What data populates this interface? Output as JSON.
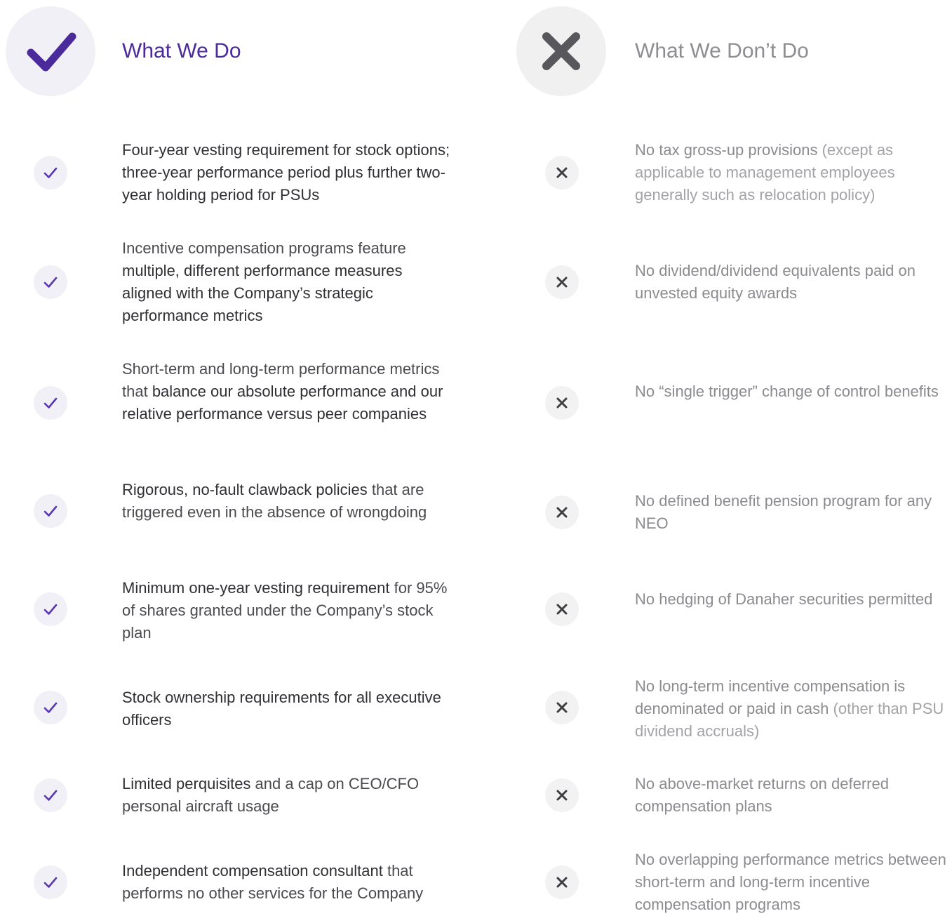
{
  "do_column": {
    "title": "What We Do",
    "header_icon": "checkmark-icon",
    "accent_color": "#4b2a9b",
    "items": [
      {
        "icon": "check-icon",
        "lead": "Four-year vesting requirement for stock options; three-year performance period plus further two-year holding period for PSUs",
        "rest": "",
        "prefix": ""
      },
      {
        "icon": "check-icon",
        "prefix": "Incentive compensation programs feature ",
        "lead": "multiple, different performance measures aligned with the Company’s strategic performance metrics",
        "rest": ""
      },
      {
        "icon": "check-icon",
        "prefix": "Short-term and long-term performance metrics that ",
        "lead": "balance our absolute performance and our relative performance versus peer companies",
        "rest": ""
      },
      {
        "icon": "check-icon",
        "prefix": "",
        "lead": "Rigorous, no-fault clawback policies",
        "rest": " that are triggered even in the absence of wrongdoing"
      },
      {
        "icon": "check-icon",
        "prefix": "",
        "lead": "Minimum one-year vesting requirement",
        "rest": " for 95% of shares granted under the Company’s stock plan"
      },
      {
        "icon": "check-icon",
        "prefix": "",
        "lead": "Stock ownership requirements for all executive officers",
        "rest": ""
      },
      {
        "icon": "check-icon",
        "prefix": "",
        "lead": "Limited perquisites",
        "rest": " and a cap on CEO/CFO personal aircraft usage"
      },
      {
        "icon": "check-icon",
        "prefix": "",
        "lead": "Independent compensation consultant",
        "rest": " that performs no other services for the Company"
      }
    ]
  },
  "dont_column": {
    "title": "What We Don’t Do",
    "header_icon": "x-mark-icon",
    "accent_color": "#58585c",
    "items": [
      {
        "icon": "x-icon",
        "prefix": "",
        "lead": "No tax gross-up provisions",
        "rest": " (except as applicable to management employees generally such as relocation policy)"
      },
      {
        "icon": "x-icon",
        "prefix": "",
        "lead": "No dividend/dividend equivalents paid on unvested equity awards",
        "rest": ""
      },
      {
        "icon": "x-icon",
        "prefix": "",
        "lead": "No “single trigger” change of control benefits",
        "rest": ""
      },
      {
        "icon": "x-icon",
        "prefix": "",
        "lead": "No defined benefit pension program for any NEO",
        "rest": ""
      },
      {
        "icon": "x-icon",
        "prefix": "",
        "lead": "No hedging of Danaher securities permitted",
        "rest": ""
      },
      {
        "icon": "x-icon",
        "prefix": "",
        "lead": "No long-term incentive compensation is denominated or paid in cash",
        "rest": " (other than PSU dividend accruals)"
      },
      {
        "icon": "x-icon",
        "prefix": "",
        "lead": "No above-market returns on deferred compensation plans",
        "rest": ""
      },
      {
        "icon": "x-icon",
        "prefix": "",
        "lead": "No overlapping performance metrics between short-term and long-term incentive compensation programs",
        "rest": ""
      }
    ]
  }
}
